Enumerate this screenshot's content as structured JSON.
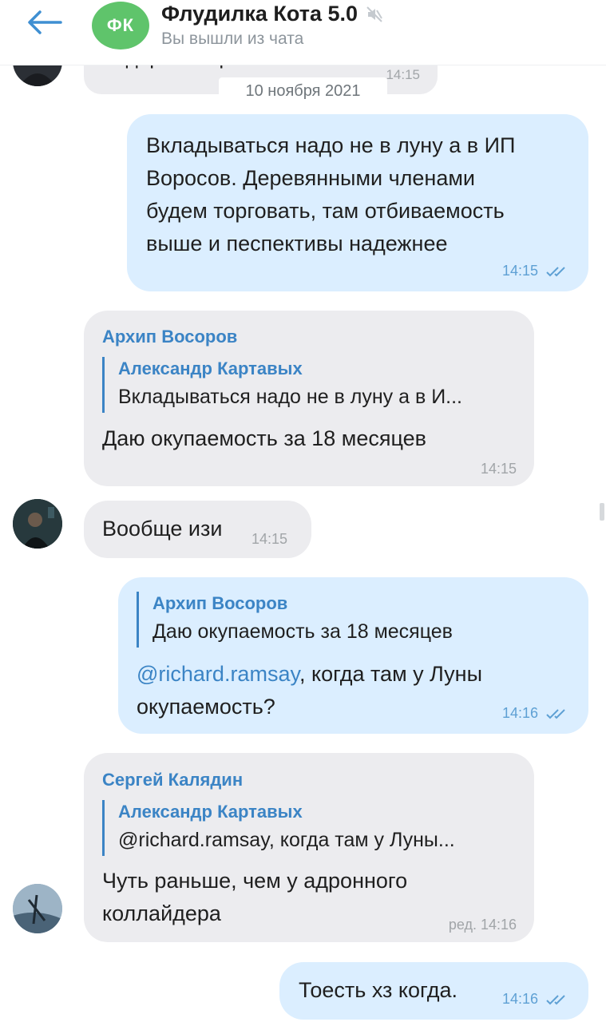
{
  "header": {
    "group_initials": "ФК",
    "title": "Флудилка Кота 5.0",
    "subtitle": "Вы вышли из чата"
  },
  "partial_message": {
    "text": "пидоры американские",
    "time": "14:15"
  },
  "date_separator": "10 ноября 2021",
  "messages": [
    {
      "id": "m1",
      "direction": "outgoing",
      "lines": [
        "Вкладываться надо не в луну а в ИП",
        "Воросов. Деревянными членами",
        "будем торговать, там отбиваемость",
        "выше и песпективы надежнее"
      ],
      "time": "14:15",
      "read": true
    },
    {
      "id": "m2",
      "direction": "incoming",
      "sender": "Архип Восоров",
      "reply_to_name": "Александр Картавых",
      "reply_to_text": "Вкладываться надо не в луну а в И...",
      "text": "Даю окупаемость за 18 месяцев",
      "time": "14:15"
    },
    {
      "id": "m3",
      "direction": "incoming",
      "text": "Вообще изи",
      "time": "14:15"
    },
    {
      "id": "m4",
      "direction": "outgoing",
      "reply_to_name": "Архип Восоров",
      "reply_to_text": "Даю окупаемость за 18 месяцев",
      "mention": "@richard.ramsay",
      "text_after_mention": ", когда там у Луны",
      "text_line2": "окупаемость?",
      "time": "14:16",
      "read": true
    },
    {
      "id": "m5",
      "direction": "incoming",
      "sender": "Сергей Калядин",
      "reply_to_name": "Александр Картавых",
      "reply_to_text": "@richard.ramsay, когда там у Луны...",
      "lines": [
        "Чуть раньше, чем у адронного",
        "коллайдера"
      ],
      "time": "ред. 14:16"
    },
    {
      "id": "m6",
      "direction": "outgoing",
      "text": "Тоесть хз когда.",
      "time": "14:16",
      "read": true
    }
  ],
  "colors": {
    "accent": "#3b84c5",
    "incoming_bubble": "#ececef",
    "outgoing_bubble": "#dbeeff",
    "group_avatar": "#5fc46b"
  },
  "icons": [
    "back-arrow-icon",
    "mute-icon",
    "double-check-icon"
  ]
}
